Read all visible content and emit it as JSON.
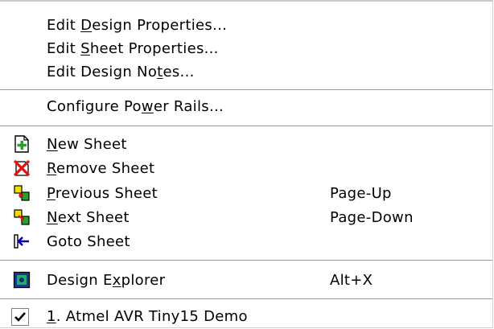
{
  "menu": {
    "items": [
      {
        "id": "edit-design-props",
        "pre": "Edit ",
        "u": "D",
        "post": "esign Properties...",
        "accel": ""
      },
      {
        "id": "edit-sheet-props",
        "pre": "Edit ",
        "u": "S",
        "post": "heet Properties...",
        "accel": ""
      },
      {
        "id": "edit-design-notes",
        "pre": "Edit Design No",
        "u": "t",
        "post": "es...",
        "accel": ""
      },
      {
        "id": "configure-power-rails",
        "pre": "Configure Po",
        "u": "w",
        "post": "er Rails...",
        "accel": ""
      },
      {
        "id": "new-sheet",
        "pre": "",
        "u": "N",
        "post": "ew Sheet",
        "accel": "",
        "icon": "new-sheet-icon"
      },
      {
        "id": "remove-sheet",
        "pre": "",
        "u": "R",
        "post": "emove Sheet",
        "accel": "",
        "icon": "remove-sheet-icon"
      },
      {
        "id": "previous-sheet",
        "pre": "",
        "u": "P",
        "post": "revious Sheet",
        "accel": "Page-Up",
        "icon": "previous-sheet-icon"
      },
      {
        "id": "next-sheet",
        "pre": "",
        "u": "N",
        "post": "ext Sheet",
        "accel": "Page-Down",
        "icon": "next-sheet-icon"
      },
      {
        "id": "goto-sheet",
        "pre": "",
        "u": "",
        "post": "Goto Sheet",
        "accel": "",
        "icon": "goto-sheet-icon"
      },
      {
        "id": "design-explorer",
        "pre": "Design E",
        "u": "x",
        "post": "plorer",
        "accel": "Alt+X",
        "icon": "design-explorer-icon"
      },
      {
        "id": "recent-design-1",
        "pre": "",
        "u": "1",
        "post": ". Atmel AVR Tiny15 Demo",
        "accel": "",
        "icon": "checkmark-icon",
        "checked": true
      }
    ]
  },
  "colors": {
    "icon_green": "#2aa02a",
    "icon_red": "#e01010",
    "icon_blue": "#0000c8",
    "icon_yellow": "#f0e000",
    "separator": "#9a9a9a"
  }
}
